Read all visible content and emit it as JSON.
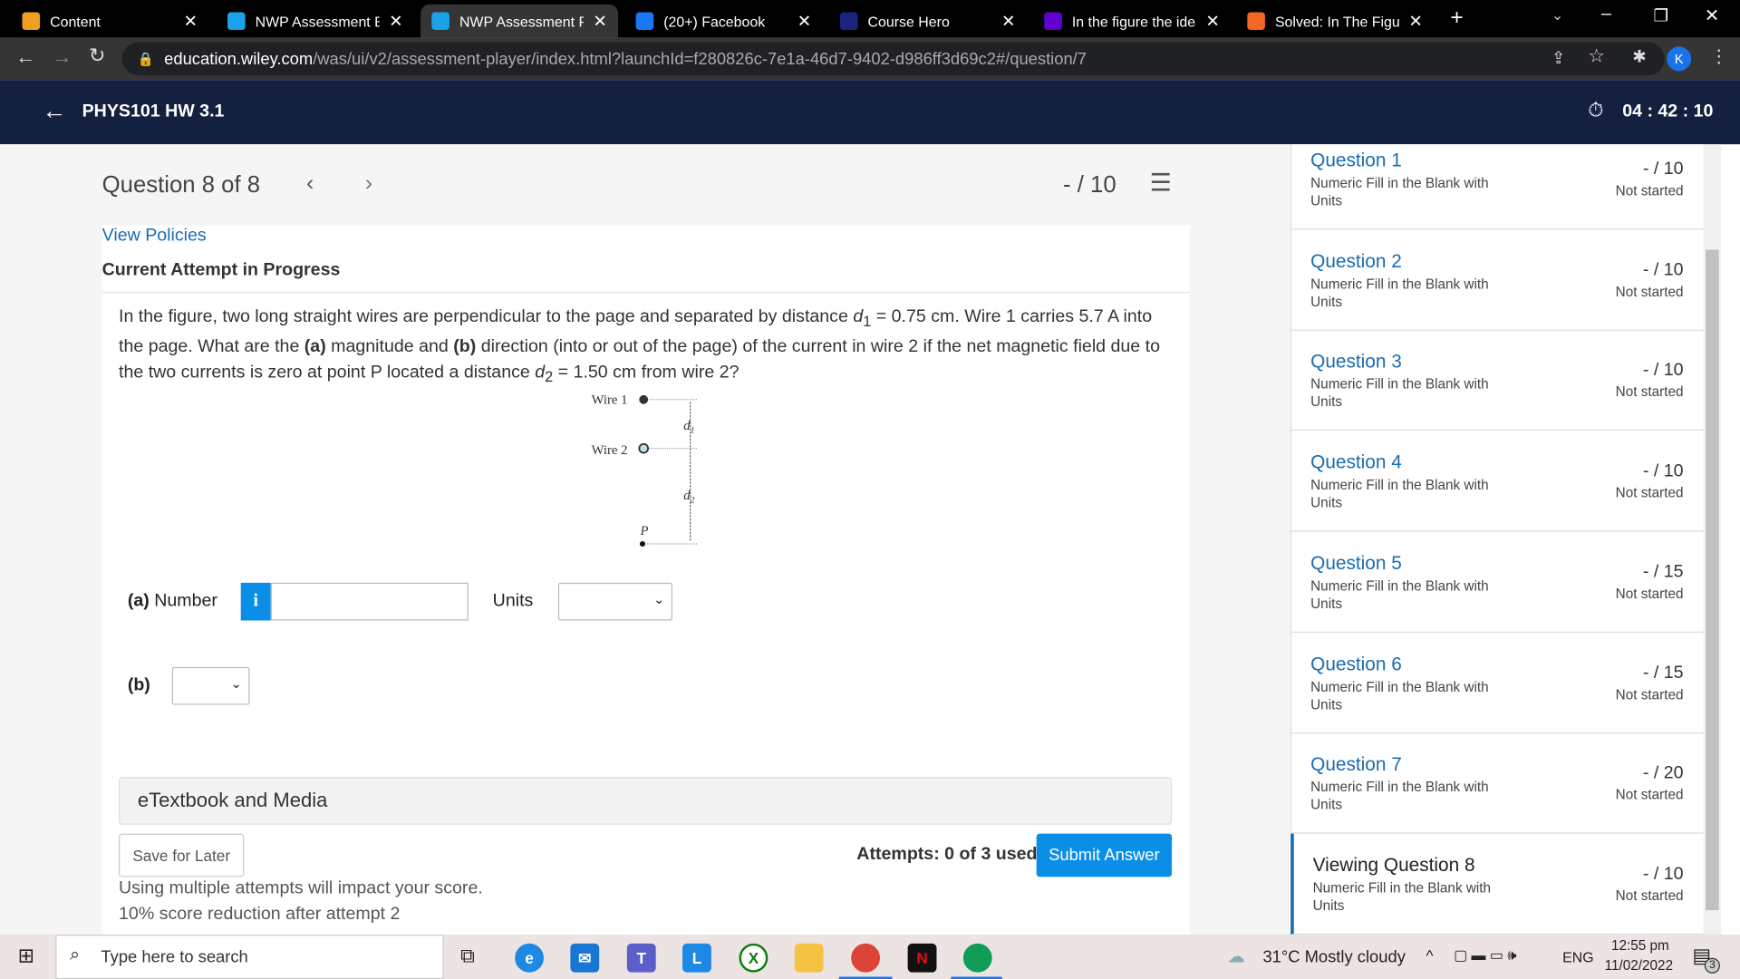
{
  "browser": {
    "tabs": [
      {
        "title": "Content",
        "icon": "pencil-icon",
        "color": "#f0a020"
      },
      {
        "title": "NWP Assessment Buil",
        "icon": "wp-icon",
        "color": "#1aa3e8"
      },
      {
        "title": "NWP Assessment Play",
        "icon": "wp-icon",
        "color": "#1aa3e8",
        "active": true
      },
      {
        "title": "(20+) Facebook",
        "icon": "facebook-icon",
        "color": "#1877f2"
      },
      {
        "title": "Course Hero",
        "icon": "star-icon",
        "color": "#1a237e"
      },
      {
        "title": "In the figure the ideal",
        "icon": "yahoo-icon",
        "color": "#6001d2"
      },
      {
        "title": "Solved: In The Figure",
        "icon": "chegg-icon",
        "color": "#f26722"
      }
    ],
    "url_host": "education.wiley.com",
    "url_path": "/was/ui/v2/assessment-player/index.html?launchId=f280826c-7e1a-46d7-9402-d986ff3d69c2#/question/7",
    "profile_initial": "K"
  },
  "header": {
    "title": "PHYS101 HW 3.1",
    "timer": "04 : 42 : 10"
  },
  "question": {
    "heading": "Question 8 of 8",
    "score": "- / 10",
    "view_policies": "View Policies",
    "attempt_status": "Current Attempt in Progress",
    "text_1": "In the figure, two long straight wires are perpendicular to the page and separated by distance ",
    "d1": "d",
    "sub1": "1",
    "text_2": " = 0.75 cm. Wire 1 carries 5.7 A into the page. What are the ",
    "a_bold": "(a)",
    "text_3": " magnitude and ",
    "b_bold": "(b)",
    "text_4": " direction (into or out of the page) of the current in wire 2 if the net magnetic field due to the two currents is zero at point P located a distance ",
    "d2": "d",
    "sub2": "2",
    "text_5": " = 1.50 cm from wire 2?",
    "figure": {
      "wire1": "Wire 1",
      "wire2": "Wire 2",
      "d1": "d",
      "d1_sub": "1",
      "d2": "d",
      "d2_sub": "2",
      "p": "P"
    },
    "part_a_label": "(a) Number",
    "number_value": "",
    "units_label": "Units",
    "units_value": "",
    "part_b_label": "(b)",
    "b_value": "",
    "etextbook": "eTextbook and Media",
    "save_later": "Save for Later",
    "attempts": "Attempts: 0 of 3 used",
    "submit": "Submit Answer",
    "note_1": "Using multiple attempts will impact your score.",
    "note_2": "10% score reduction after attempt 2"
  },
  "sidebar": {
    "items": [
      {
        "title": "Question 1",
        "type": "Numeric Fill in the Blank with Units",
        "points": "- / 10",
        "status": "Not started"
      },
      {
        "title": "Question 2",
        "type": "Numeric Fill in the Blank with Units",
        "points": "- / 10",
        "status": "Not started"
      },
      {
        "title": "Question 3",
        "type": "Numeric Fill in the Blank with Units",
        "points": "- / 10",
        "status": "Not started"
      },
      {
        "title": "Question 4",
        "type": "Numeric Fill in the Blank with Units",
        "points": "- / 10",
        "status": "Not started"
      },
      {
        "title": "Question 5",
        "type": "Numeric Fill in the Blank with Units",
        "points": "- / 15",
        "status": "Not started"
      },
      {
        "title": "Question 6",
        "type": "Numeric Fill in the Blank with Units",
        "points": "- / 15",
        "status": "Not started"
      },
      {
        "title": "Question 7",
        "type": "Numeric Fill in the Blank with Units",
        "points": "- / 20",
        "status": "Not started"
      },
      {
        "title": "Viewing Question 8",
        "type": "Numeric Fill in the Blank with Units",
        "points": "- / 10",
        "status": "Not started",
        "current": true
      }
    ]
  },
  "taskbar": {
    "search_placeholder": "Type here to search",
    "weather": "31°C  Mostly cloudy",
    "lang": "ENG",
    "time": "12:55 pm",
    "date": "11/02/2022",
    "notifications": "3"
  },
  "colors": {
    "header": "#14203f",
    "accent": "#1a6cb0",
    "button": "#0b8ee8"
  }
}
